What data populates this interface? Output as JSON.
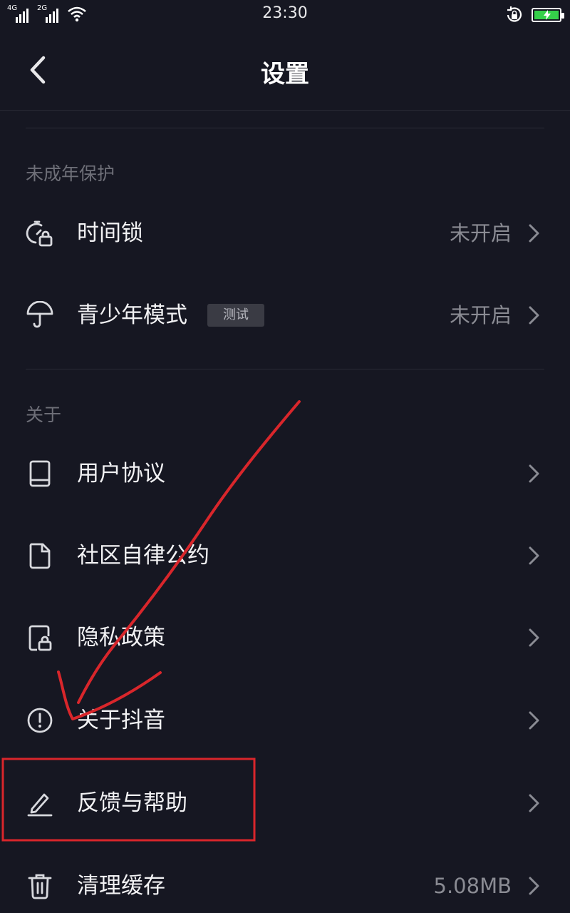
{
  "status_bar": {
    "time": "23:30",
    "signal1": "4G",
    "signal2": "2G",
    "battery_color": "#35d04a"
  },
  "header": {
    "title": "设置",
    "back_icon": "chevron-left-icon"
  },
  "sections": {
    "minor": {
      "title": "未成年保护",
      "time_lock": {
        "label": "时间锁",
        "value": "未开启",
        "icon": "timer-lock-icon"
      },
      "teen_mode": {
        "label": "青少年模式",
        "badge": "测试",
        "value": "未开启",
        "icon": "umbrella-icon"
      }
    },
    "about": {
      "title": "关于",
      "user_agreement": {
        "label": "用户协议",
        "icon": "book-icon"
      },
      "community": {
        "label": "社区自律公约",
        "icon": "document-icon"
      },
      "privacy": {
        "label": "隐私政策",
        "icon": "lock-document-icon"
      },
      "about_app": {
        "label": "关于抖音",
        "icon": "exclamation-circle-icon"
      },
      "feedback": {
        "label": "反馈与帮助",
        "icon": "pencil-icon"
      },
      "cache": {
        "label": "清理缓存",
        "value": "5.08MB",
        "icon": "trash-icon"
      }
    }
  },
  "annotation": {
    "color": "#d9262b"
  }
}
